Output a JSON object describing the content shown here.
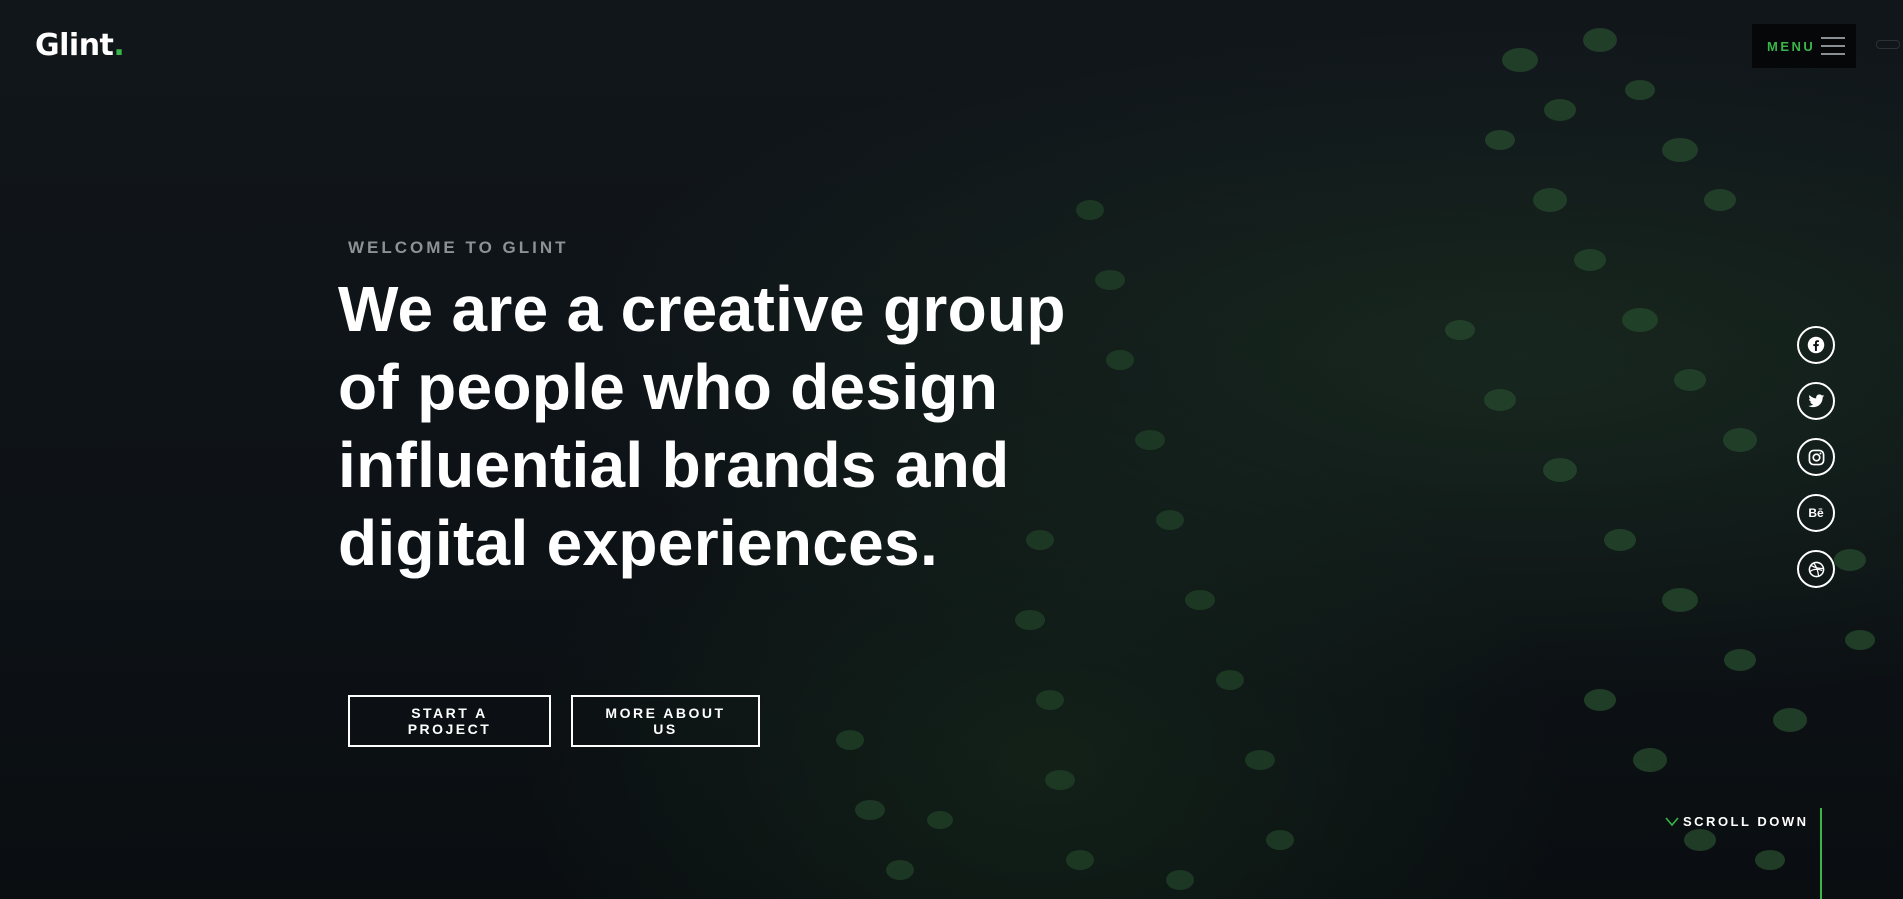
{
  "brand": {
    "name": "Glint",
    "dot": ".",
    "accent_color": "#39b54a"
  },
  "header": {
    "menu_label": "MENU",
    "menu_icon": "hamburger-icon"
  },
  "hero": {
    "eyebrow": "WELCOME TO GLINT",
    "headline": "We are a creative group of people who design influential brands and digital experiences.",
    "buttons": [
      {
        "label": "START A PROJECT"
      },
      {
        "label": "MORE ABOUT US"
      }
    ]
  },
  "social": [
    {
      "name": "facebook",
      "icon": "facebook-icon"
    },
    {
      "name": "twitter",
      "icon": "twitter-icon"
    },
    {
      "name": "instagram",
      "icon": "instagram-icon"
    },
    {
      "name": "behance",
      "icon": "behance-icon",
      "glyph": "Bē"
    },
    {
      "name": "dribbble",
      "icon": "dribbble-icon"
    }
  ],
  "scroll": {
    "label": "SCROLL DOWN",
    "icon": "chevron-down-icon"
  }
}
